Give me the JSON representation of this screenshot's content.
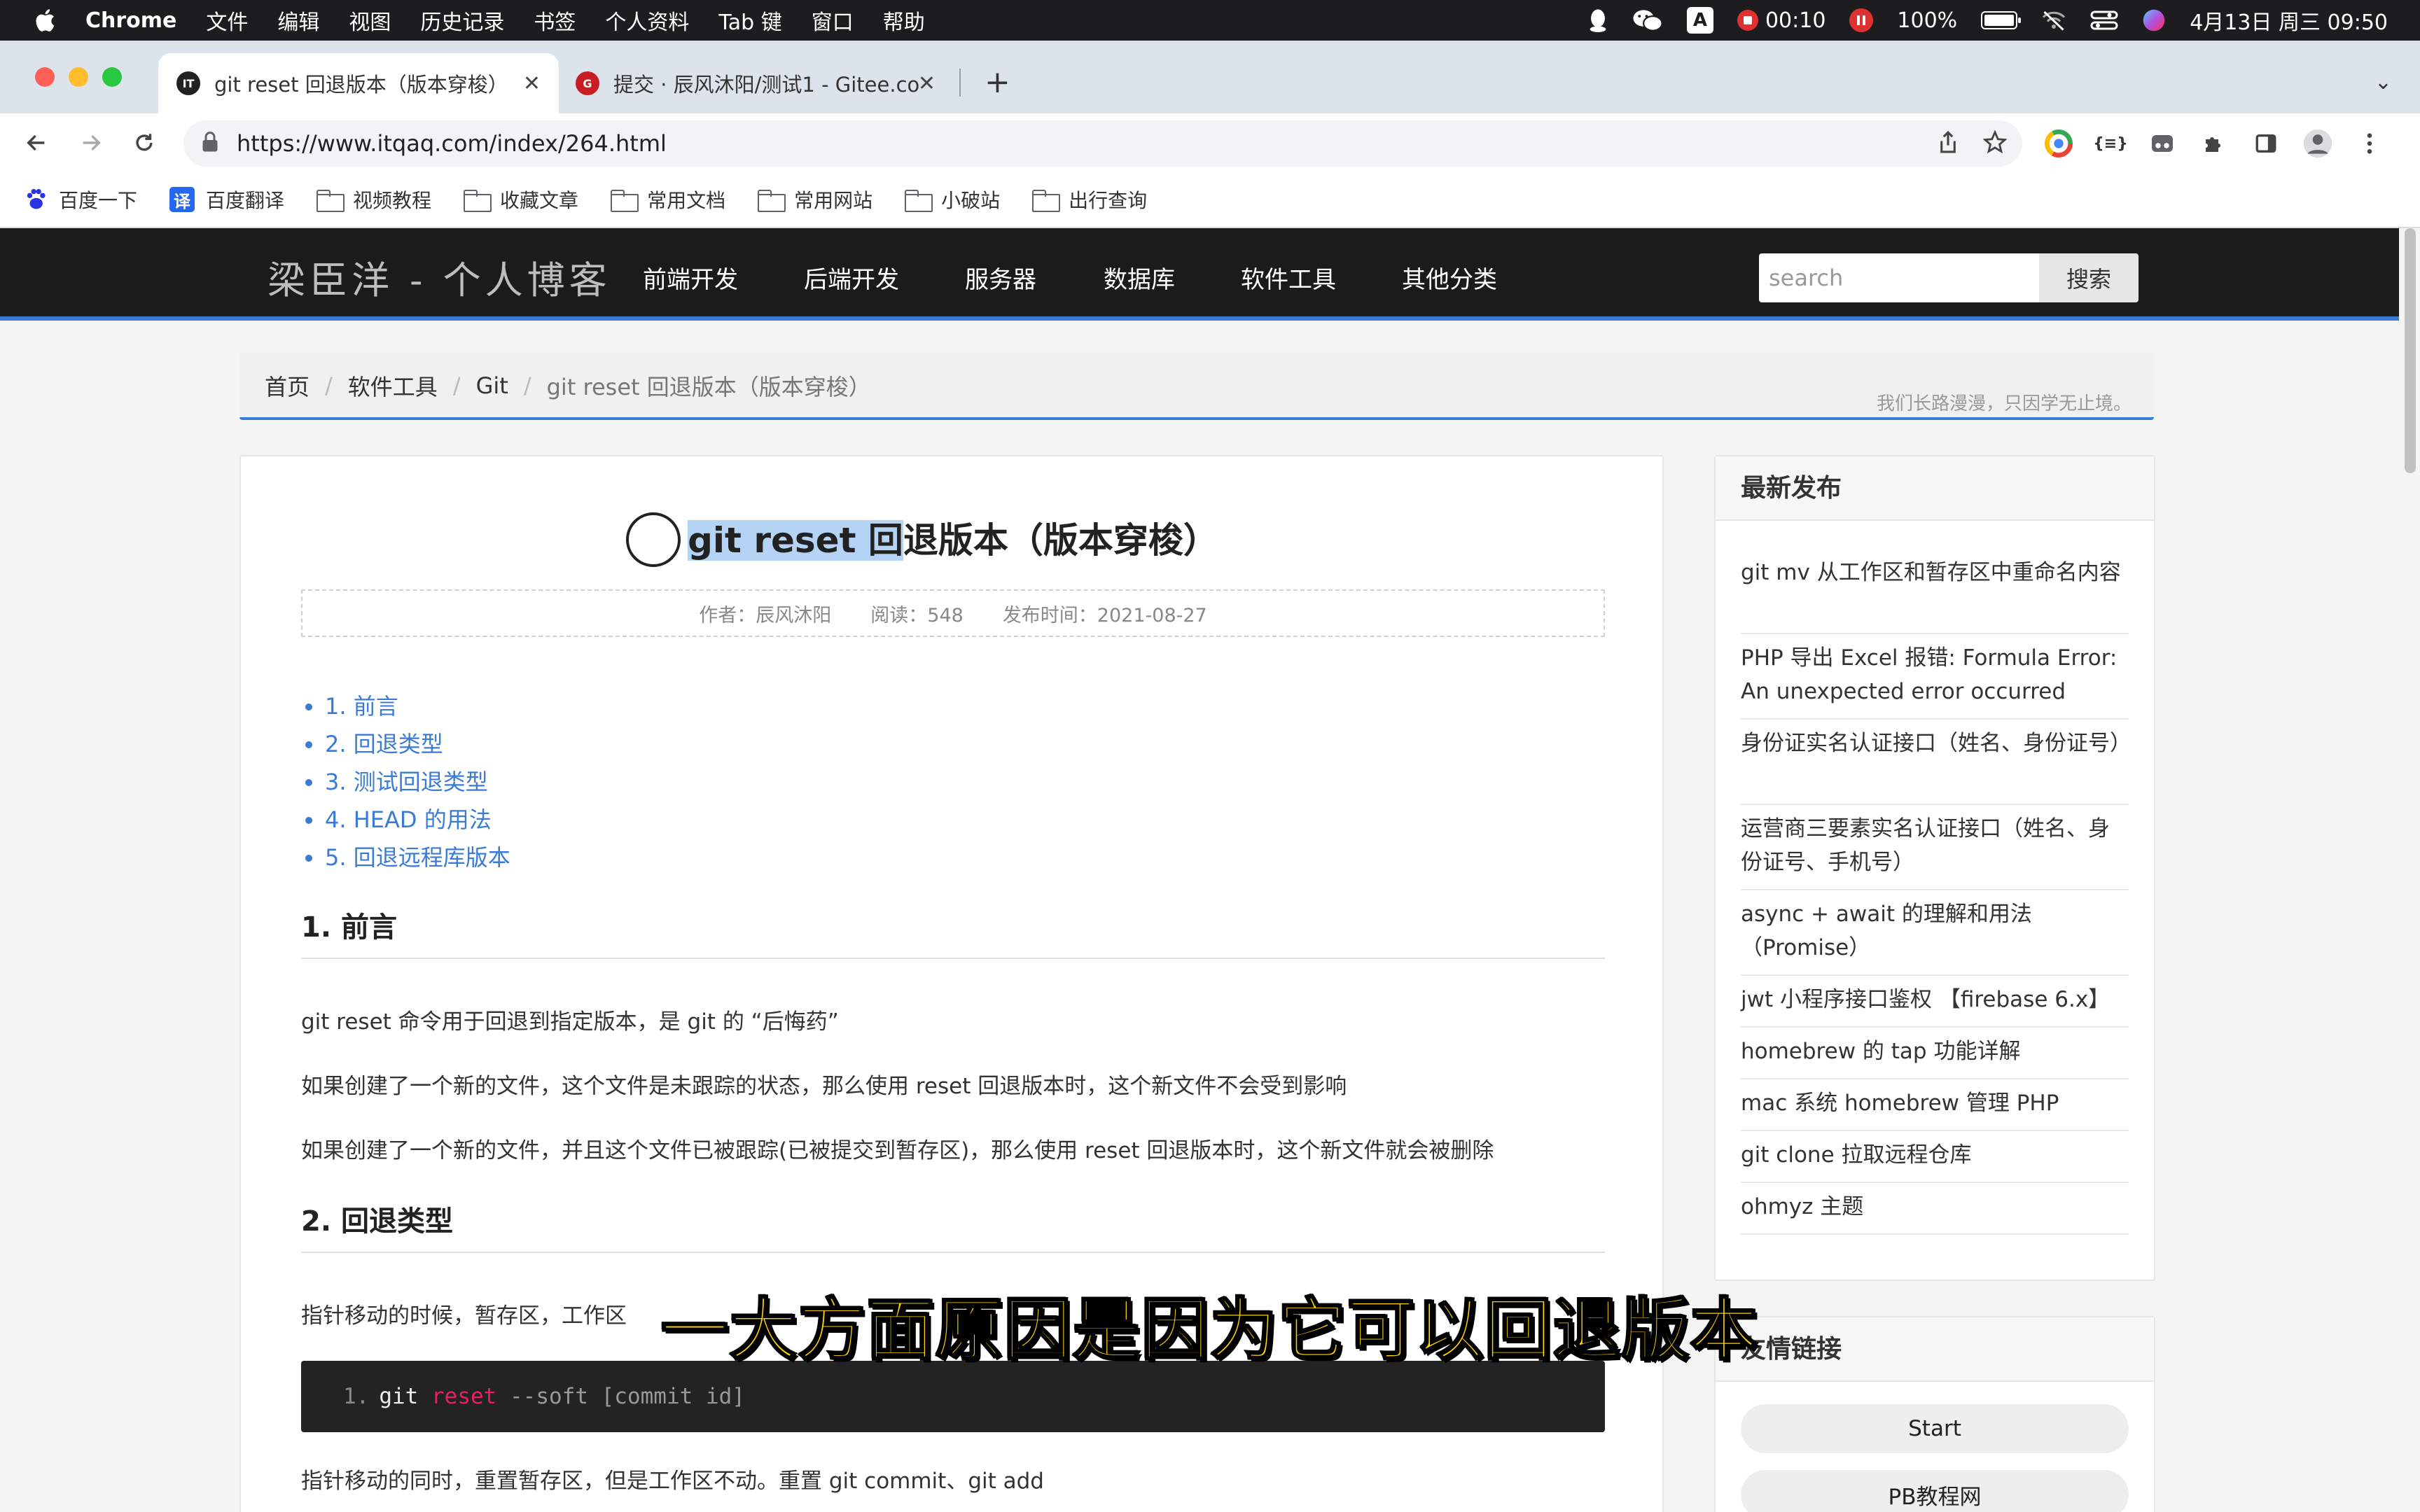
{
  "menubar": {
    "app": "Chrome",
    "items": [
      "文件",
      "编辑",
      "视图",
      "历史记录",
      "书签",
      "个人资料",
      "Tab 键",
      "窗口",
      "帮助"
    ],
    "recording_time": "00:10",
    "battery": "100%",
    "datetime": "4月13日 周三  09:50",
    "input_badge": "A"
  },
  "tabs": [
    {
      "title": "git reset 回退版本（版本穿梭）",
      "favicon_text": "IT",
      "favicon_color": "#222222",
      "active": true
    },
    {
      "title": "提交 · 辰风沐阳/测试1 - Gitee.co",
      "favicon_text": "G",
      "favicon_color": "#c71d23",
      "active": false
    }
  ],
  "toolbar": {
    "url": "https://www.itqaq.com/index/264.html"
  },
  "bookmarks": [
    "百度一下",
    "百度翻译",
    "视频教程",
    "收藏文章",
    "常用文档",
    "常用网站",
    "小破站",
    "出行查询"
  ],
  "site": {
    "logo": "梁臣洋 - 个人博客",
    "nav": [
      "前端开发",
      "后端开发",
      "服务器",
      "数据库",
      "软件工具",
      "其他分类"
    ],
    "search_placeholder": "search",
    "search_button": "搜索",
    "breadcrumb": [
      "首页",
      "软件工具",
      "Git",
      "git reset 回退版本（版本穿梭）"
    ],
    "motto": "我们长路漫漫，只因学无止境。"
  },
  "article": {
    "title_selected": "git reset 回",
    "title_rest": "退版本（版本穿梭）",
    "author": "作者：辰风沐阳",
    "reads": "阅读：548",
    "published": "发布时间：2021-08-27",
    "toc": [
      "1. 前言",
      "2. 回退类型",
      "3. 测试回退类型",
      "4. HEAD 的用法",
      "5. 回退远程库版本"
    ],
    "h_intro": "1. 前言",
    "p1": "git reset 命令用于回退到指定版本，是 git 的 “后悔药”",
    "p2": "如果创建了一个新的文件，这个文件是未跟踪的状态，那么使用 reset 回退版本时，这个新文件不会受到影响",
    "p3": "如果创建了一个新的文件，并且这个文件已被跟踪(已被提交到暂存区)，那么使用 reset 回退版本时，这个新文件就会被删除",
    "h_types": "2. 回退类型",
    "p4": "指针移动的时候，暂存区，工作区",
    "code_line_no": "1.",
    "code_git": "git",
    "code_reset": "reset",
    "code_rest": "--soft [commit id]",
    "p5": "指针移动的同时，重置暂存区，但是工作区不动。重置 git commit、git add"
  },
  "sidebar": {
    "latest_title": "最新发布",
    "latest": [
      "git mv 从工作区和暂存区中重命名内容",
      "PHP 导出 Excel 报错: Formula Error: An unexpected error occurred",
      "身份证实名认证接口（姓名、身份证号）",
      "运营商三要素实名认证接口（姓名、身份证号、手机号）",
      "async + await 的理解和用法（Promise）",
      "jwt 小程序接口鉴权 【firebase 6.x】",
      "homebrew 的 tap 功能详解",
      "mac 系统 homebrew 管理 PHP",
      "git clone 拉取远程仓库",
      "ohmyz 主题"
    ],
    "friends_title": "友情链接",
    "friends": [
      "Start",
      "PB教程网"
    ]
  },
  "subtitle": "一大方面原因是因为它可以回退版本"
}
